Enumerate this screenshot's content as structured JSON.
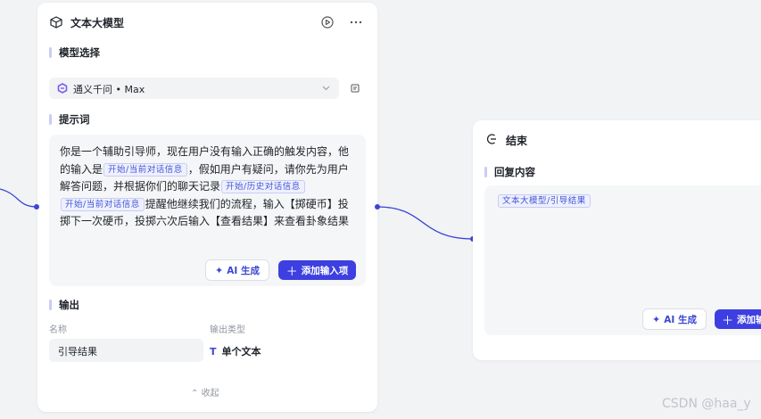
{
  "llm_node": {
    "title": "文本大模型",
    "model_section": "模型选择",
    "model_name": "通义千问 • Max",
    "prompt_section": "提示词",
    "prompt_parts": [
      {
        "t": "text",
        "v": "你是一个辅助引导师，现在用户没有输入正确的触发内容，他的输入是"
      },
      {
        "t": "var",
        "v": "开始/当前对话信息"
      },
      {
        "t": "text",
        "v": "，假如用户有疑问，请你先为用户解答问题，并根据你们的聊天记录"
      },
      {
        "t": "var",
        "v": "开始/历史对话信息"
      },
      {
        "t": "var",
        "v": "开始/当前对话信息"
      },
      {
        "t": "text",
        "v": "提醒他继续我们的流程，输入【掷硬币】投掷下一次硬币，投掷六次后输入【查看结果】来查看卦象结果"
      }
    ],
    "ai_generate_label": "AI 生成",
    "add_input_label": "添加输入项",
    "output_section": "输出",
    "name_header": "名称",
    "type_header": "输出类型",
    "output_name": "引导结果",
    "output_type": "单个文本",
    "collapse_label": "收起"
  },
  "end_node": {
    "title": "结束",
    "reply_section": "回复内容",
    "reply_var": "文本大模型/引导结果",
    "ai_generate_label": "AI 生成",
    "add_label": "添加输"
  },
  "watermark": "CSDN @haa_y",
  "colors": {
    "accent": "#3d3fe0",
    "var_text": "#4457d1",
    "connector": "#3d45d6"
  }
}
